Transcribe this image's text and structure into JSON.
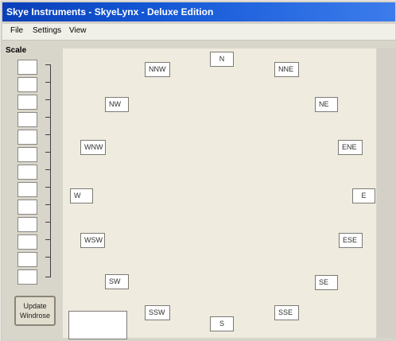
{
  "window": {
    "title": "Skye Instruments - SkyeLynx - Deluxe Edition"
  },
  "menu": {
    "items": [
      "File",
      "Settings",
      "View"
    ]
  },
  "scale": {
    "label": "Scale",
    "boxes": [
      "",
      "",
      "",
      "",
      "",
      "",
      "",
      "",
      "",
      "",
      "",
      "",
      "",
      ""
    ]
  },
  "compass": {
    "N": "N",
    "NNE": "NNE",
    "NE": "NE",
    "ENE": "ENE",
    "E": "E",
    "ESE": "ESE",
    "SE": "SE",
    "SSE": "SSE",
    "S": "S",
    "SSW": "SSW",
    "SW": "SW",
    "WSW": "WSW",
    "W": "W",
    "WNW": "WNW",
    "NW": "NW",
    "NNW": "NNW"
  },
  "update_button": {
    "line1": "Update",
    "line2": "Windrose"
  },
  "input": {
    "value": ""
  }
}
